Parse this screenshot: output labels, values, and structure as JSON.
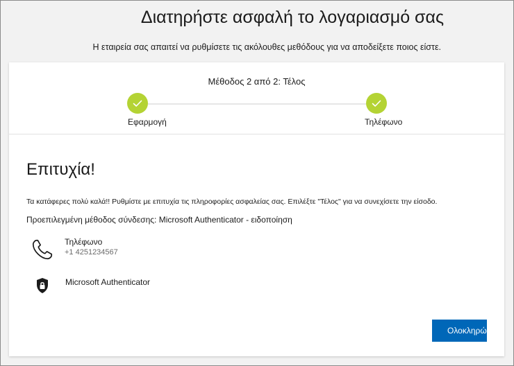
{
  "header": {
    "title": "Διατηρήστε ασφαλή το λογαριασμό σας",
    "subtitle": "Η εταιρεία σας απαιτεί να ρυθμίσετε τις ακόλουθες μεθόδους για να αποδείξετε ποιος είστε."
  },
  "progress": {
    "step_label": "Μέθοδος 2 από 2: Τέλος",
    "steps": [
      {
        "label": "Εφαρμογή",
        "status": "complete"
      },
      {
        "label": "Τηλέφωνο",
        "status": "complete"
      }
    ],
    "check_color": "#b4d334"
  },
  "content": {
    "heading": "Επιτυχία!",
    "message": "Τα κατάφερες πολύ καλά!! Ρυθμίστε με επιτυχία τις πληροφορίες ασφαλείας σας. Επιλέξτε \"Τέλος\" για να συνεχίσετε την είσοδο.",
    "default_method": "Προεπιλεγμένη μέθοδος σύνδεσης: Microsoft Authenticator - ειδοποίηση",
    "methods": [
      {
        "name": "Τηλέφωνο",
        "detail": "+1 4251234567",
        "icon": "phone-icon"
      },
      {
        "name": "Microsoft Authenticator",
        "icon": "authenticator-lock-icon"
      }
    ]
  },
  "actions": {
    "done_label": "Ολοκληρώθηκε",
    "button_color": "#0067b8"
  }
}
